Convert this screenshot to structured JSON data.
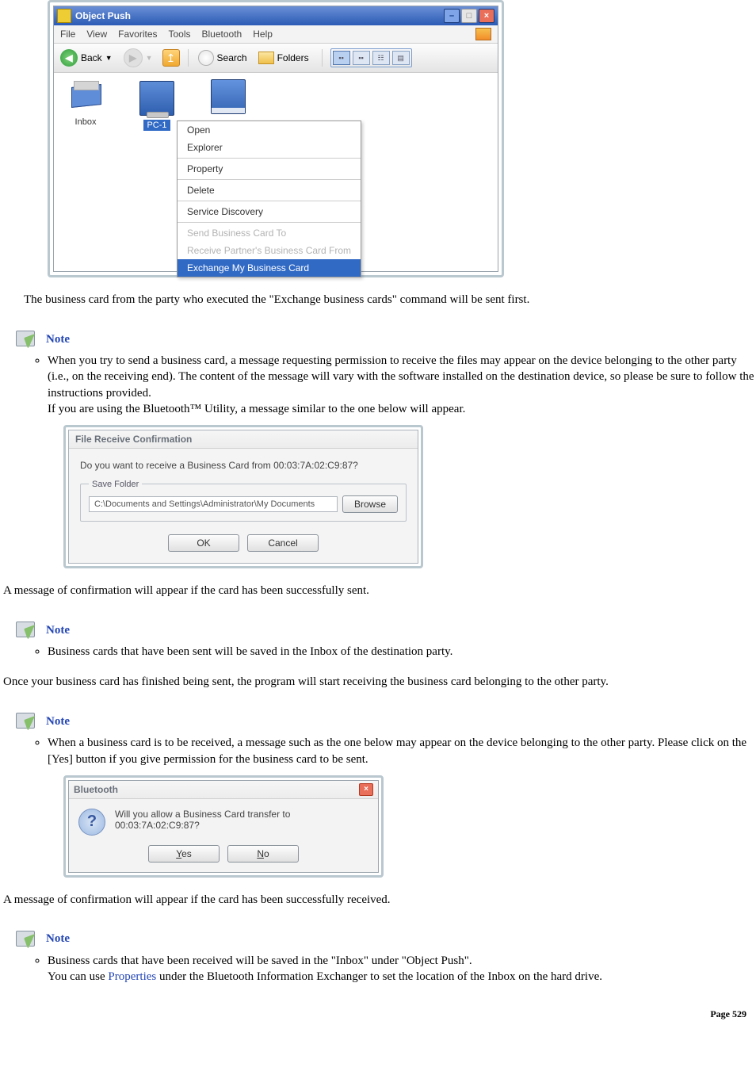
{
  "page_number": "Page 529",
  "screenshot1": {
    "title": "Object Push",
    "menu": [
      "File",
      "View",
      "Favorites",
      "Tools",
      "Bluetooth",
      "Help"
    ],
    "toolbar": {
      "back": "Back",
      "search": "Search",
      "folders": "Folders"
    },
    "items": {
      "inbox": "Inbox",
      "pc1": "PC-1"
    },
    "context_menu": {
      "open": "Open",
      "explorer": "Explorer",
      "property": "Property",
      "delete": "Delete",
      "service_discovery": "Service Discovery",
      "send_card": "Send Business Card To",
      "receive_card": "Receive Partner's Business Card From",
      "exchange_card": "Exchange My Business Card"
    }
  },
  "para1": "The business card from the party who executed the \"Exchange business cards\" command will be sent first.",
  "note_label": "Note",
  "note1_text": "When you try to send a business card, a message requesting permission to receive the files may appear on the device belonging to the other party (i.e., on the receiving end). The content of the message will vary with the software installed on the destination device, so please be sure to follow the instructions provided.",
  "note1_sub": "If you are using the Bluetooth™ Utility, a message similar to the one below will appear.",
  "dlg_recv": {
    "title": "File Receive Confirmation",
    "question": "Do you want to receive a Business Card from 00:03:7A:02:C9:87?",
    "legend": "Save Folder",
    "path": "C:\\Documents and Settings\\Administrator\\My Documents",
    "browse": "Browse",
    "ok": "OK",
    "cancel": "Cancel"
  },
  "para2": "A message of confirmation will appear if the card has been successfully sent.",
  "note2_text": "Business cards that have been sent will be saved in the Inbox of the destination party.",
  "para3": "Once your business card has finished being sent, the program will start receiving the business card belonging to the other party.",
  "note3_text": "When a business card is to be received, a message such as the one below may appear on the device belonging to the other party. Please click on the [Yes] button if you give permission for the business card to be sent.",
  "dlg_bt": {
    "title": "Bluetooth",
    "question": "Will you allow a Business Card transfer to 00:03:7A:02:C9:87?",
    "yes": "Yes",
    "no": "No"
  },
  "para4": "A message of confirmation will appear if the card has been successfully received.",
  "note4_text_a": "Business cards that have been received will be saved in the \"Inbox\" under \"Object Push\".",
  "note4_text_b_pre": "You can use ",
  "note4_text_b_link": "Properties",
  "note4_text_b_post": " under the Bluetooth Information Exchanger to set the location of the Inbox on the hard drive."
}
